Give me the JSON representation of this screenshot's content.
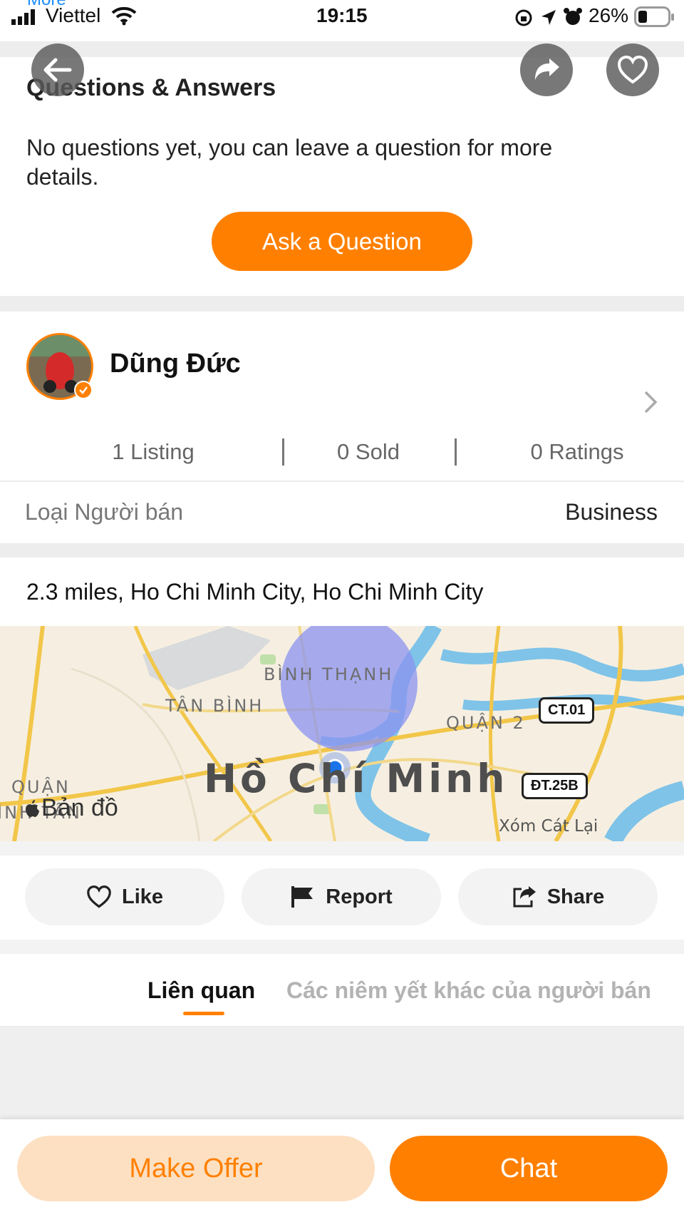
{
  "status_bar": {
    "carrier": "Viettel",
    "time": "19:15",
    "battery": "26%",
    "cut_off_link": "More"
  },
  "qa": {
    "title": "Questions & Answers",
    "empty_message": "No questions yet, you can leave a question for more details.",
    "ask_button": "Ask a Question"
  },
  "seller": {
    "name": "Dũng Đức",
    "stats": {
      "listing": "1 Listing",
      "sold": "0 Sold",
      "ratings": "0 Ratings"
    },
    "type_label": "Loại Người bán",
    "type_value": "Business"
  },
  "location": {
    "text": "2.3 miles, Ho Chi Minh City, Ho Chi Minh City",
    "map": {
      "attribution": "Bản đồ",
      "city_label": "Hồ Chí Minh",
      "district_labels": [
        "BÌNH THẠNH",
        "TÂN BÌNH",
        "QUẬN 2",
        "QUẬN",
        "ÌNH TÂN"
      ],
      "road_shields": [
        "CT.01",
        "ĐT.25B"
      ],
      "place_label": "Xóm Cát Lại"
    }
  },
  "actions": {
    "like": "Like",
    "report": "Report",
    "share": "Share"
  },
  "tabs": {
    "related": "Liên quan",
    "seller_other": "Các niêm yết khác của người bán"
  },
  "bottom": {
    "make_offer": "Make Offer",
    "chat": "Chat"
  },
  "colors": {
    "accent": "#ff8000",
    "offer_bg": "#fde0c2",
    "map_circle": "#8b93f0"
  }
}
